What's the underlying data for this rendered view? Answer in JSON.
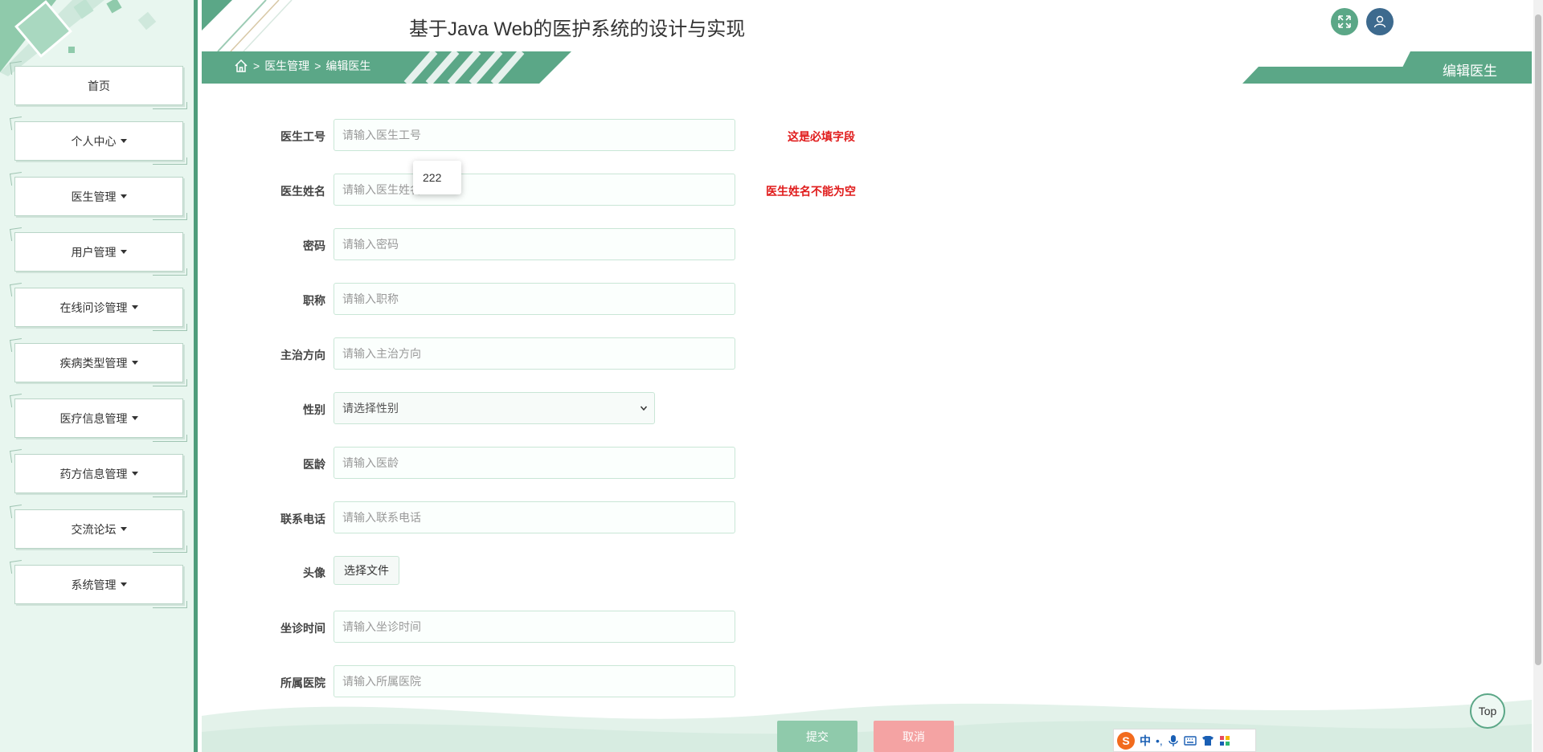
{
  "site_title": "基于Java Web的医护系统的设计与实现",
  "breadcrumb": {
    "sep": ">",
    "parent": "医生管理",
    "current": "编辑医生"
  },
  "page_tab": "编辑医生",
  "sidebar": {
    "items": [
      {
        "label": "首页",
        "dropdown": false
      },
      {
        "label": "个人中心",
        "dropdown": true
      },
      {
        "label": "医生管理",
        "dropdown": true
      },
      {
        "label": "用户管理",
        "dropdown": true
      },
      {
        "label": "在线问诊管理",
        "dropdown": true
      },
      {
        "label": "疾病类型管理",
        "dropdown": true
      },
      {
        "label": "医疗信息管理",
        "dropdown": true
      },
      {
        "label": "药方信息管理",
        "dropdown": true
      },
      {
        "label": "交流论坛",
        "dropdown": true
      },
      {
        "label": "系统管理",
        "dropdown": true
      }
    ]
  },
  "form": {
    "doctor_id": {
      "label": "医生工号",
      "placeholder": "请输入医生工号",
      "error": "这是必填字段"
    },
    "doctor_name": {
      "label": "医生姓名",
      "placeholder": "请输入医生姓名",
      "error": "医生姓名不能为空"
    },
    "password": {
      "label": "密码",
      "placeholder": "请输入密码"
    },
    "title": {
      "label": "职称",
      "placeholder": "请输入职称"
    },
    "specialty": {
      "label": "主治方向",
      "placeholder": "请输入主治方向"
    },
    "gender": {
      "label": "性别",
      "selected": "请选择性别"
    },
    "years": {
      "label": "医龄",
      "placeholder": "请输入医龄"
    },
    "phone": {
      "label": "联系电话",
      "placeholder": "请输入联系电话"
    },
    "avatar": {
      "label": "头像",
      "button": "选择文件"
    },
    "schedule": {
      "label": "坐诊时间",
      "placeholder": "请输入坐诊时间"
    },
    "hospital": {
      "label": "所属医院",
      "placeholder": "请输入所属医院"
    }
  },
  "autocomplete_suggestion": "222",
  "buttons": {
    "submit": "提交",
    "cancel": "取消"
  },
  "top_button": "Top",
  "ime": {
    "logo": "S",
    "mode": "中",
    "punct": "•,",
    "icons": [
      "mic-icon",
      "keyboard-icon",
      "skin-icon",
      "apps-icon"
    ]
  },
  "colors": {
    "primary": "#5ba787",
    "sidebar_bg": "#e8f6ef",
    "error": "#e01b1b",
    "user": "#3d6a8e"
  }
}
